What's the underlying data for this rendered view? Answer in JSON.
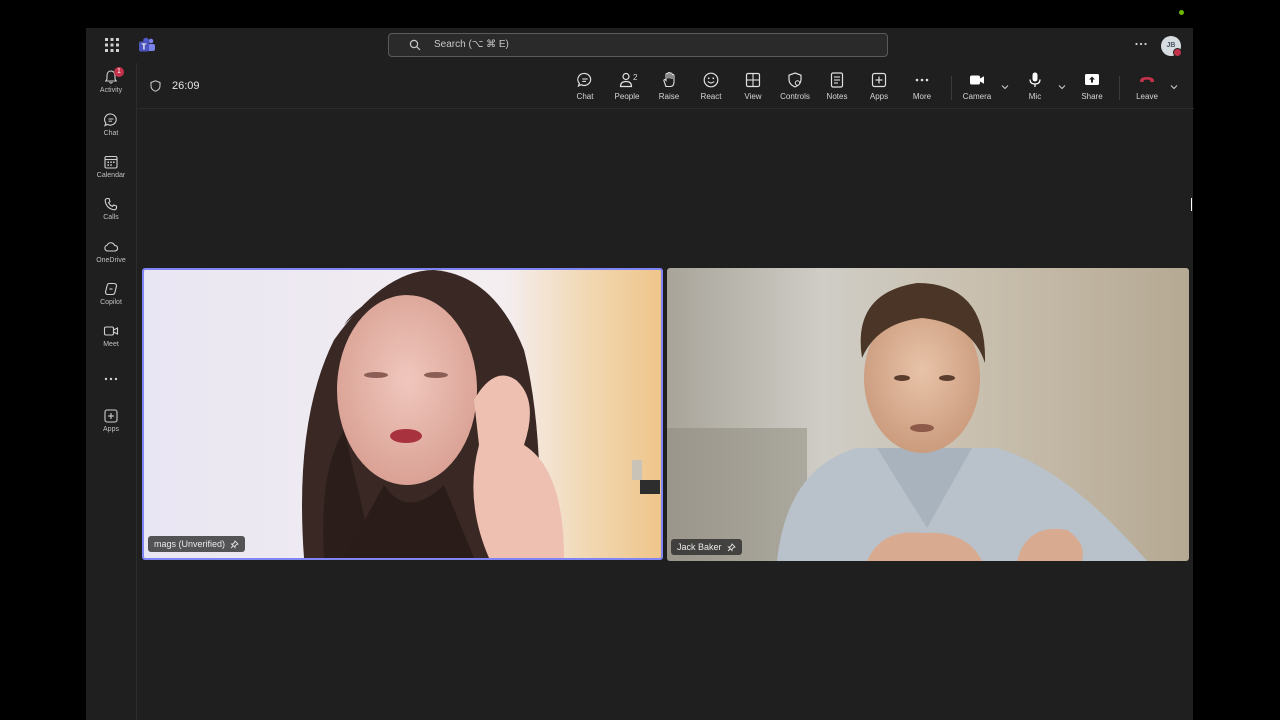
{
  "topbar": {
    "search_placeholder": "Search (⌥ ⌘ E)",
    "avatar_initials": "JB"
  },
  "rail": {
    "items": [
      {
        "label": "Activity",
        "icon": "bell-icon",
        "badge": "1"
      },
      {
        "label": "Chat",
        "icon": "chat-icon"
      },
      {
        "label": "Calendar",
        "icon": "calendar-icon"
      },
      {
        "label": "Calls",
        "icon": "phone-icon"
      },
      {
        "label": "OneDrive",
        "icon": "cloud-icon"
      },
      {
        "label": "Copilot",
        "icon": "copilot-icon"
      },
      {
        "label": "Meet",
        "icon": "video-icon"
      },
      {
        "label": "",
        "icon": "more-icon"
      },
      {
        "label": "Apps",
        "icon": "add-apps-icon"
      }
    ]
  },
  "meeting": {
    "timer": "26:09",
    "toolbar": {
      "chat": "Chat",
      "people": "People",
      "people_count": "2",
      "raise": "Raise",
      "react": "React",
      "view": "View",
      "controls": "Controls",
      "notes": "Notes",
      "apps": "Apps",
      "more": "More",
      "camera": "Camera",
      "mic": "Mic",
      "share": "Share",
      "leave": "Leave"
    },
    "participants": [
      {
        "name": "mags (Unverified)",
        "active_speaker": true
      },
      {
        "name": "Jack Baker",
        "active_speaker": false
      }
    ]
  },
  "colors": {
    "app_bg": "#1f1f1f",
    "accent": "#7f85f5",
    "leave": "#c4314b",
    "badge": "#c4314b"
  }
}
